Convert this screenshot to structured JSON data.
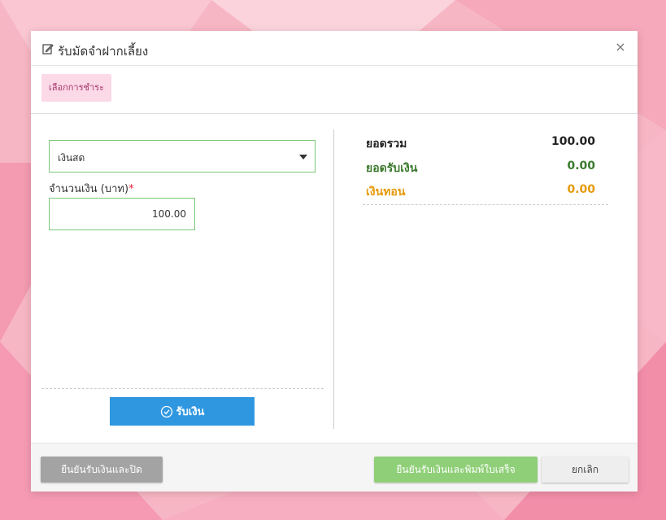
{
  "modal": {
    "title": "รับมัดจำฝากเลี้ยง",
    "close_symbol": "×"
  },
  "tabs": [
    {
      "label": "เลือกการชำระ"
    }
  ],
  "payment": {
    "method_selected": "เงินสด",
    "amount_label": "จำนวนเงิน (บาท)",
    "required_mark": "*",
    "amount_value": "100.00",
    "receive_button_label": "รับเงิน"
  },
  "summary": {
    "total_label": "ยอดรวม",
    "total_value": "100.00",
    "received_label": "ยอดรับเงิน",
    "received_value": "0.00",
    "change_label": "เงินทอน",
    "change_value": "0.00"
  },
  "footer": {
    "confirm_close_label": "ยืนยันรับเงินและปิด",
    "confirm_print_label": "ยืนยันรับเงินและพิมพ์ใบเสร็จ",
    "cancel_label": "ยกเลิก"
  },
  "colors": {
    "tab_bg": "#fbd9e6",
    "tab_text": "#a7336b",
    "input_border": "#79c879",
    "receive_button": "#2f97e0",
    "received_text": "#3b7a2e",
    "change_text": "#e69a0c",
    "confirm_close_bg": "#a3a3a3",
    "confirm_print_bg": "#8fcf78",
    "cancel_bg": "#eeeeee",
    "required": "#e2233a"
  },
  "icons": {
    "title": "edit-icon",
    "close": "close-icon",
    "select": "caret-down-icon",
    "receive": "check-circle-icon"
  }
}
